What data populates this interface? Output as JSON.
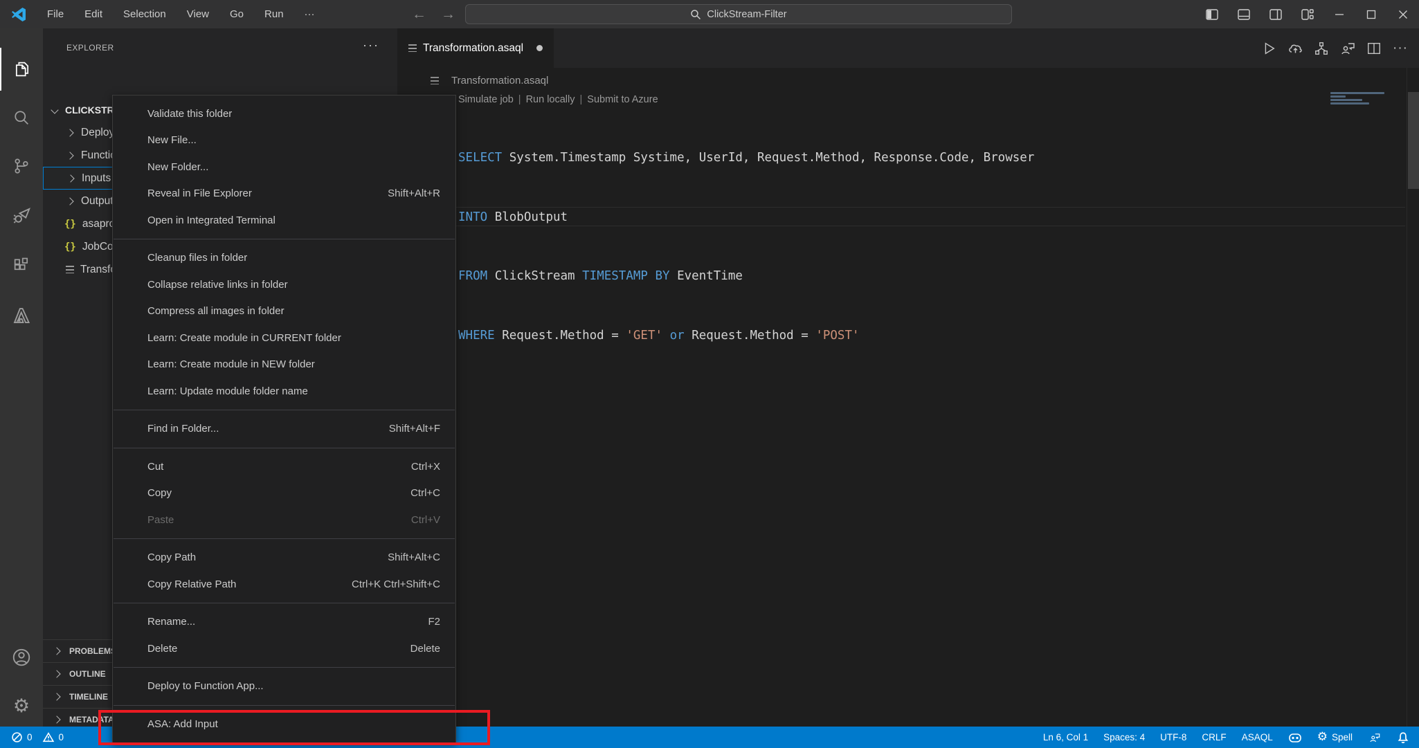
{
  "colors": {
    "status_bar": "#007acc",
    "annotation_red": "#ea1b22",
    "keyword": "#569cd6",
    "string": "#ce9178",
    "selection_border": "#007fd4",
    "json_icon": "#cbcb41"
  },
  "titlebar": {
    "menus": [
      "File",
      "Edit",
      "Selection",
      "View",
      "Go",
      "Run",
      "···"
    ],
    "search_text": "ClickStream-Filter"
  },
  "sidebar": {
    "title": "EXPLORER",
    "more_label": "···",
    "root": "CLICKSTREAM-FILTER",
    "items": [
      {
        "label": "Deploy",
        "kind": "folder"
      },
      {
        "label": "Functions",
        "kind": "folder"
      },
      {
        "label": "Inputs",
        "kind": "folder",
        "selected": true
      },
      {
        "label": "Outputs",
        "kind": "folder"
      },
      {
        "label": "asaproj.json",
        "kind": "json"
      },
      {
        "label": "JobConfig.json",
        "kind": "json"
      },
      {
        "label": "Transformation.asaql",
        "kind": "file"
      }
    ],
    "sections": [
      "PROBLEMS",
      "OUTLINE",
      "TIMELINE",
      "METADATA"
    ]
  },
  "editor": {
    "tab_label": "Transformation.asaql",
    "breadcrumb": "Transformation.asaql",
    "codelens": {
      "links": [
        "Simulate job",
        "Run locally",
        "Submit to Azure"
      ],
      "separator": "|"
    },
    "code_lines": [
      {
        "tokens": [
          {
            "t": "SELECT ",
            "c": "kw"
          },
          {
            "t": "System.Timestamp Systime, UserId, Request.Method, Response.Code, Browser",
            "c": "id"
          }
        ]
      },
      {
        "tokens": [
          {
            "t": "INTO ",
            "c": "kw"
          },
          {
            "t": "BlobOutput",
            "c": "id"
          }
        ]
      },
      {
        "tokens": [
          {
            "t": "FROM ",
            "c": "kw"
          },
          {
            "t": "ClickStream ",
            "c": "id"
          },
          {
            "t": "TIMESTAMP BY ",
            "c": "kw"
          },
          {
            "t": "EventTime",
            "c": "id"
          }
        ]
      },
      {
        "tokens": [
          {
            "t": "WHERE ",
            "c": "kw"
          },
          {
            "t": "Request.Method ",
            "c": "id"
          },
          {
            "t": "= ",
            "c": "op"
          },
          {
            "t": "'GET'",
            "c": "str"
          },
          {
            "t": " ",
            "c": "id"
          },
          {
            "t": "or",
            "c": "kw"
          },
          {
            "t": " ",
            "c": "id"
          },
          {
            "t": "Request.Method ",
            "c": "id"
          },
          {
            "t": "= ",
            "c": "op"
          },
          {
            "t": "'POST'",
            "c": "str"
          }
        ]
      }
    ]
  },
  "context_menu": {
    "items": [
      {
        "label": "Validate this folder",
        "shortcut": ""
      },
      {
        "label": "New File...",
        "shortcut": ""
      },
      {
        "label": "New Folder...",
        "shortcut": ""
      },
      {
        "label": "Reveal in File Explorer",
        "shortcut": "Shift+Alt+R"
      },
      {
        "label": "Open in Integrated Terminal",
        "shortcut": ""
      },
      {
        "label": "Cleanup files in folder",
        "shortcut": ""
      },
      {
        "label": "Collapse relative links in folder",
        "shortcut": ""
      },
      {
        "label": "Compress all images in folder",
        "shortcut": ""
      },
      {
        "label": "Learn: Create module in CURRENT folder",
        "shortcut": ""
      },
      {
        "label": "Learn: Create module in NEW folder",
        "shortcut": ""
      },
      {
        "label": "Learn: Update module folder name",
        "shortcut": ""
      },
      {
        "label": "Find in Folder...",
        "shortcut": "Shift+Alt+F"
      },
      {
        "label": "Cut",
        "shortcut": "Ctrl+X"
      },
      {
        "label": "Copy",
        "shortcut": "Ctrl+C"
      },
      {
        "label": "Paste",
        "shortcut": "Ctrl+V",
        "disabled": true
      },
      {
        "label": "Copy Path",
        "shortcut": "Shift+Alt+C"
      },
      {
        "label": "Copy Relative Path",
        "shortcut": "Ctrl+K Ctrl+Shift+C"
      },
      {
        "label": "Rename...",
        "shortcut": "F2"
      },
      {
        "label": "Delete",
        "shortcut": "Delete"
      },
      {
        "label": "Deploy to Function App...",
        "shortcut": ""
      },
      {
        "label": "ASA: Add Input",
        "shortcut": ""
      }
    ]
  },
  "statusbar": {
    "error_count": "0",
    "warning_count": "0",
    "cursor": "Ln 6, Col 1",
    "indent": "Spaces: 4",
    "encoding": "UTF-8",
    "eol": "CRLF",
    "language": "ASAQL",
    "spell": "Spell"
  }
}
